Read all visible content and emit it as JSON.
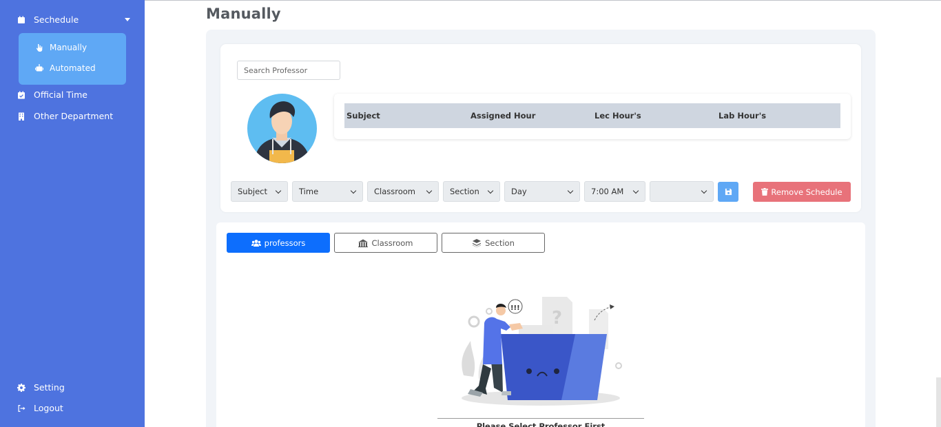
{
  "sidebar": {
    "items": [
      {
        "label": "Sechedule",
        "icon": "calendar-icon"
      },
      {
        "label": "Official Time",
        "icon": "calendar-check-icon"
      },
      {
        "label": "Other Department",
        "icon": "building-icon"
      }
    ],
    "submenu": [
      {
        "label": "Manually",
        "icon": "hand-pointer-icon"
      },
      {
        "label": "Automated",
        "icon": "robot-icon"
      }
    ],
    "footer": [
      {
        "label": "Setting",
        "icon": "gear-icon"
      },
      {
        "label": "Logout",
        "icon": "sign-out-icon"
      }
    ]
  },
  "page": {
    "title": "Manually"
  },
  "search": {
    "placeholder": "Search Professor",
    "value": ""
  },
  "table": {
    "headers": [
      "Subject",
      "Assigned Hour",
      "Lec Hour's",
      "Lab Hour's"
    ]
  },
  "filters": {
    "subject": "Subject",
    "time": "Time",
    "classroom": "Classroom",
    "section": "Section",
    "day": "Day",
    "start_time": "7:00 AM",
    "end_time": ""
  },
  "buttons": {
    "remove": "Remove Schedule"
  },
  "tabs": [
    {
      "label": "professors",
      "active": true
    },
    {
      "label": "Classroom",
      "active": false
    },
    {
      "label": "Section",
      "active": false
    }
  ],
  "empty_state": {
    "message": "Please Select Professor First"
  },
  "colors": {
    "sidebar": "#4e73df",
    "submenu": "#5fa8f5",
    "primary": "#0d6efd",
    "danger": "#e8727a"
  }
}
